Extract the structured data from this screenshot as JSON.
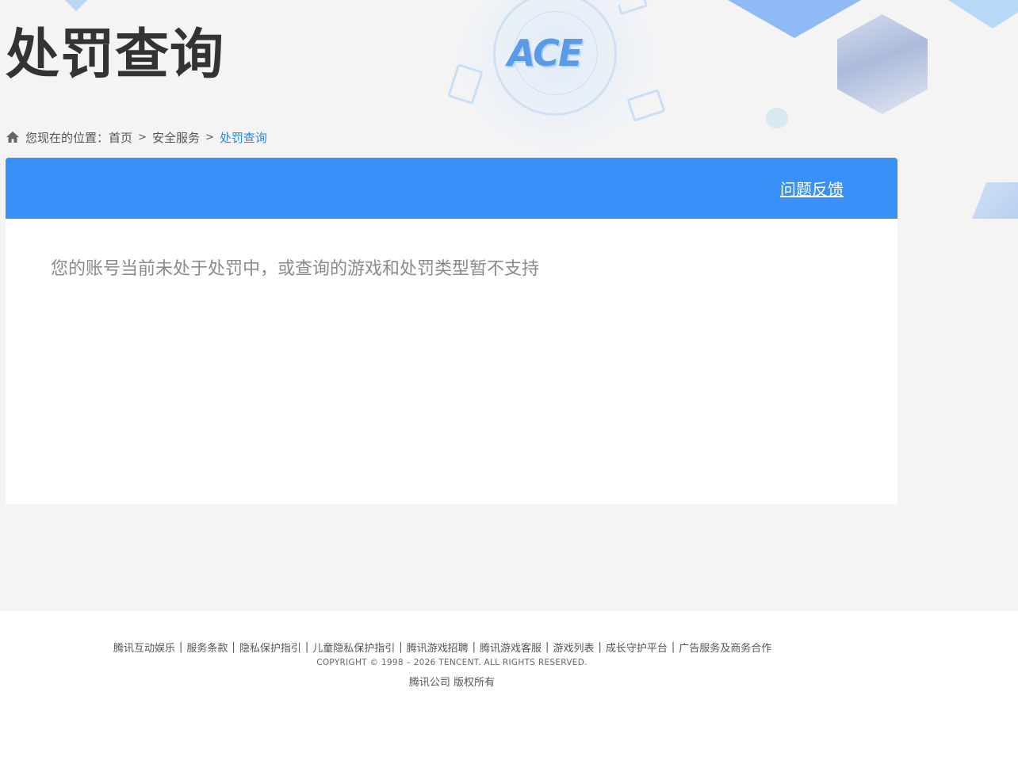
{
  "header": {
    "title": "处罚查询",
    "logo_text": "ACE"
  },
  "breadcrumb": {
    "prefix": "您现在的位置：",
    "items": [
      "首页",
      "安全服务"
    ],
    "separator": ">",
    "current": "处罚查询",
    "icon": "home-icon"
  },
  "panel": {
    "feedback_label": "问题反馈",
    "message": "您的账号当前未处于处罚中，或查询的游戏和处罚类型暂不支持",
    "accent_color": "#3990f6"
  },
  "footer": {
    "links": [
      "腾讯互动娱乐",
      "服务条款",
      "隐私保护指引",
      "儿童隐私保护指引",
      "腾讯游戏招聘",
      "腾讯游戏客服",
      "游戏列表",
      "成长守护平台",
      "广告服务及商务合作"
    ],
    "separator": "|",
    "copyright": "COPYRIGHT © 1998 – 2026 TENCENT. ALL RIGHTS RESERVED.",
    "owner": "腾讯公司 版权所有"
  }
}
